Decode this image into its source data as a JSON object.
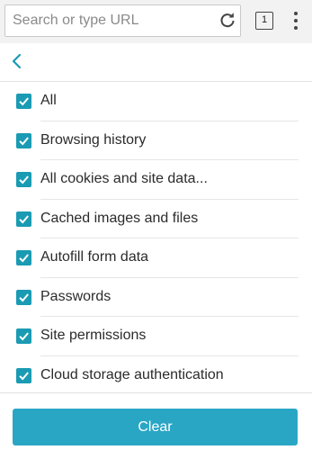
{
  "toolbar": {
    "omnibox_placeholder": "Search or type URL",
    "omnibox_value": "",
    "tab_count": "1",
    "reload_icon": "reload-icon",
    "menu_icon": "more-vert-icon"
  },
  "nav": {
    "back_icon": "chevron-left-icon"
  },
  "items": [
    {
      "label": "All",
      "checked": true
    },
    {
      "label": "Browsing history",
      "checked": true
    },
    {
      "label": "All cookies and site data...",
      "checked": true
    },
    {
      "label": "Cached images and files",
      "checked": true
    },
    {
      "label": "Autofill form data",
      "checked": true
    },
    {
      "label": "Passwords",
      "checked": true
    },
    {
      "label": "Site permissions",
      "checked": true
    },
    {
      "label": "Cloud storage authentication",
      "checked": true
    }
  ],
  "footer": {
    "clear_label": "Clear"
  },
  "colors": {
    "accent": "#2aa6c5",
    "checkbox": "#1a9bb3",
    "toolbar_bg": "#f2f2f2"
  }
}
